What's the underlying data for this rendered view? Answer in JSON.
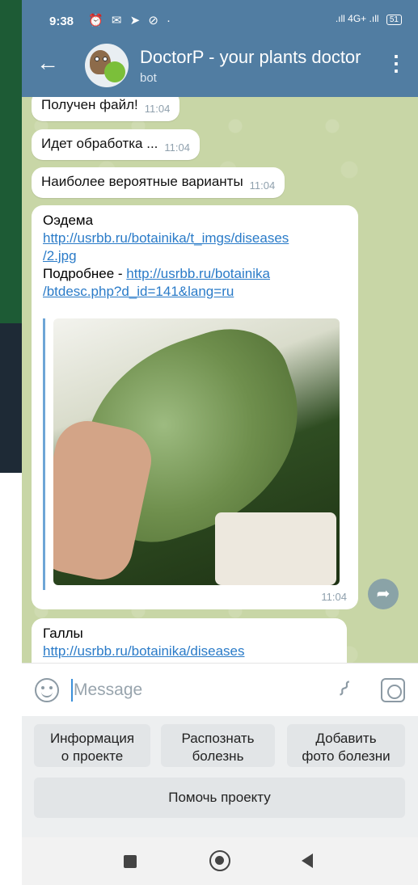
{
  "status_bar": {
    "time": "9:38",
    "left_icons": "⏰ ✉ ➤ ⊘ ·",
    "network": "4G+",
    "battery": "51"
  },
  "header": {
    "title": "DoctorP - your plants doctor",
    "subtitle": "bot"
  },
  "messages": [
    {
      "text": "Получен файл!",
      "time": "11:04"
    },
    {
      "text": "Идет обработка ...",
      "time": "11:04"
    },
    {
      "text": "Наиболее вероятные варианты",
      "time": "11:04"
    }
  ],
  "result_card": {
    "name": "Оэдема",
    "image_link_1": "http://usrbb.ru/botainika/t_imgs/diseases",
    "image_link_2": "/2.jpg",
    "more_label": "Подробнее - ",
    "more_link_1": "http://usrbb.ru/botainika",
    "more_link_2": "/btdesc.php?d_id=141&lang=ru",
    "time": "11:04"
  },
  "result_card_2": {
    "name": "Галлы",
    "link": "http://usrbb.ru/botainika/diseases"
  },
  "input": {
    "placeholder": "Message"
  },
  "keyboard": {
    "btn_info_line1": "Информация",
    "btn_info_line2": "о проекте",
    "btn_recognize_line1": "Распознать",
    "btn_recognize_line2": "болезнь",
    "btn_add_line1": "Добавить",
    "btn_add_line2": "фото болезни",
    "btn_help": "Помочь проекту"
  },
  "colors": {
    "header": "#517da2",
    "link": "#2a7bc8",
    "chat_bg": "#c8d6a6"
  }
}
